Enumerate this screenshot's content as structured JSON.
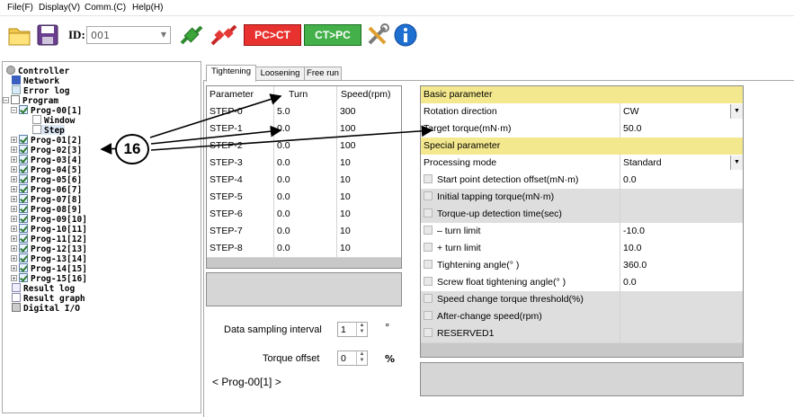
{
  "menu": [
    "File(F)",
    "Display(V)",
    "Comm.(C)",
    "Help(H)"
  ],
  "toolbar": {
    "id_label": "ID:",
    "id_value": "001",
    "pc_to_ct": "PC>CT",
    "ct_to_pc": "CT>PC"
  },
  "tree": {
    "controller": "Controller",
    "network": "Network",
    "error_log": "Error log",
    "program": "Program",
    "prog00": "Prog-00[1]",
    "window": "Window",
    "step": "Step",
    "progs": [
      "Prog-01[2]",
      "Prog-02[3]",
      "Prog-03[4]",
      "Prog-04[5]",
      "Prog-05[6]",
      "Prog-06[7]",
      "Prog-07[8]",
      "Prog-08[9]",
      "Prog-09[10]",
      "Prog-10[11]",
      "Prog-11[12]",
      "Prog-12[13]",
      "Prog-13[14]",
      "Prog-14[15]",
      "Prog-15[16]"
    ],
    "result_log": "Result log",
    "result_graph": "Result graph",
    "digital_io": "Digital I/O"
  },
  "tabs": [
    "Tightening",
    "Loosening",
    "Free run"
  ],
  "step_table": {
    "headers": [
      "Parameter",
      "Turn",
      "Speed(rpm)"
    ],
    "rows": [
      [
        "STEP-0",
        "5.0",
        "300"
      ],
      [
        "STEP-1",
        "0.0",
        "100"
      ],
      [
        "STEP-2",
        "0.0",
        "100"
      ],
      [
        "STEP-3",
        "0.0",
        "10"
      ],
      [
        "STEP-4",
        "0.0",
        "10"
      ],
      [
        "STEP-5",
        "0.0",
        "10"
      ],
      [
        "STEP-6",
        "0.0",
        "10"
      ],
      [
        "STEP-7",
        "0.0",
        "10"
      ],
      [
        "STEP-8",
        "0.0",
        "10"
      ]
    ]
  },
  "sampling": {
    "label": "Data sampling interval",
    "value": "1",
    "unit": "°"
  },
  "torque_offset": {
    "label": "Torque offset",
    "value": "0",
    "unit": "%"
  },
  "prog_nav": "< Prog-00[1] >",
  "basic": {
    "title": "Basic parameter",
    "rotation_label": "Rotation direction",
    "rotation_value": "CW",
    "torque_label": "Target torque(mN·m)",
    "torque_value": "50.0"
  },
  "special": {
    "title": "Special parameter",
    "mode_label": "Processing mode",
    "mode_value": "Standard",
    "rows": [
      {
        "label": "Start point detection offset(mN·m)",
        "value": "0.0"
      },
      {
        "label": "Initial tapping torque(mN·m)",
        "value": ""
      },
      {
        "label": "Torque-up detection time(sec)",
        "value": ""
      },
      {
        "label": "– turn limit",
        "value": "-10.0"
      },
      {
        "label": "+ turn limit",
        "value": "10.0"
      },
      {
        "label": "Tightening angle(° )",
        "value": "360.0"
      },
      {
        "label": "Screw float tightening angle(° )",
        "value": "0.0"
      },
      {
        "label": "Speed change torque threshold(%)",
        "value": ""
      },
      {
        "label": "After-change speed(rpm)",
        "value": ""
      },
      {
        "label": "RESERVED1",
        "value": ""
      }
    ]
  },
  "callout": "16",
  "colors": {
    "section_yellow": "#f3e88e",
    "callout_border": "#000000"
  }
}
